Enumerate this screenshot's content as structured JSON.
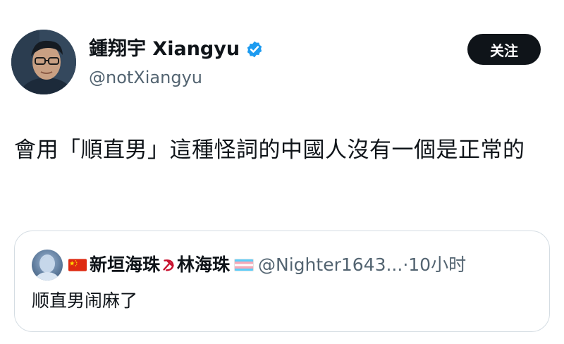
{
  "author": {
    "display_name": "鍾翔宇 Xiangyu",
    "handle": "@notXiangyu",
    "verified": true,
    "verified_color": "#1d9bf0"
  },
  "follow_button": {
    "label": "关注"
  },
  "tweet": {
    "text": "會用「順直男」這種怪詞的中國人沒有一個是正常的"
  },
  "quoted_tweet": {
    "display_name_left": "新垣海珠",
    "display_name_right": "林海珠",
    "handle": "@Nighter1643...",
    "separator": " · ",
    "time": "10小时",
    "text": "顺直男闹麻了",
    "flags": [
      "china-flag-icon",
      "hammer-sickle-icon",
      "transgender-flag-icon"
    ]
  }
}
